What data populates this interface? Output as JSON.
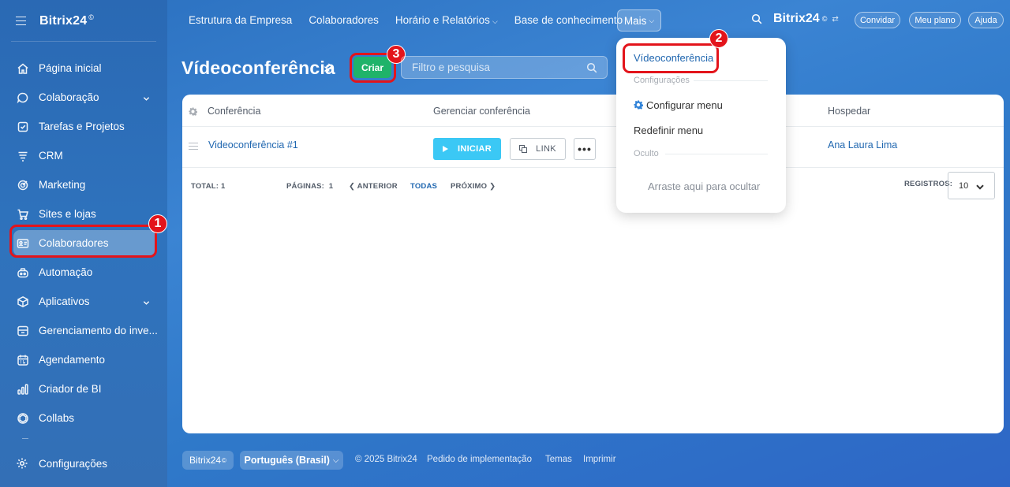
{
  "sidebar": {
    "brand": "Bitrix24",
    "brand_mark": "©",
    "items": [
      {
        "label": "Página inicial",
        "icon": "home-icon"
      },
      {
        "label": "Colaboração",
        "icon": "chat-icon",
        "expandable": true
      },
      {
        "label": "Tarefas e Projetos",
        "icon": "task-icon"
      },
      {
        "label": "CRM",
        "icon": "crm-icon"
      },
      {
        "label": "Marketing",
        "icon": "marketing-icon"
      },
      {
        "label": "Sites e lojas",
        "icon": "cart-icon"
      },
      {
        "label": "Colaboradores",
        "icon": "id-card-icon",
        "active": true
      },
      {
        "label": "Automação",
        "icon": "robot-icon"
      },
      {
        "label": "Aplicativos",
        "icon": "cube-icon",
        "expandable": true
      },
      {
        "label": "Gerenciamento do inve...",
        "icon": "inventory-icon"
      },
      {
        "label": "Agendamento",
        "icon": "calendar-icon"
      },
      {
        "label": "Criador de BI",
        "icon": "bar-chart-icon"
      },
      {
        "label": "Collabs",
        "icon": "collabs-icon"
      }
    ],
    "settings_label": "Configurações"
  },
  "topbar": {
    "nav": [
      {
        "label": "Estrutura da Empresa",
        "caret": false
      },
      {
        "label": "Colaboradores",
        "caret": false
      },
      {
        "label": "Horário e Relatórios",
        "caret": true
      },
      {
        "label": "Base de conhecimento",
        "caret": false
      }
    ],
    "more_label": "Mais",
    "brand": "Bitrix24",
    "brand_mark": "©",
    "invite_label": "Convidar",
    "plan_label": "Meu plano",
    "help_label": "Ajuda"
  },
  "page": {
    "title": "Vídeoconferência",
    "create_label": "Criar",
    "filter_placeholder": "Filtro e pesquisa"
  },
  "table": {
    "columns": {
      "conference": "Conferência",
      "manage": "Gerenciar conferência",
      "host": "Hospedar"
    },
    "rows": [
      {
        "conference": "Videoconferência #1",
        "start_label": "INICIAR",
        "link_label": "LINK",
        "more_label": "•••",
        "host": "Ana Laura Lima"
      }
    ],
    "pager": {
      "total_label": "TOTAL:",
      "total_value": "1",
      "pages_label": "PÁGINAS:",
      "pages_value": "1",
      "prev_label": "ANTERIOR",
      "all_label": "TODAS",
      "next_label": "PRÓXIMO",
      "records_label": "REGISTROS:",
      "records_value": "10"
    }
  },
  "dropdown": {
    "item_video": "Vídeoconferência",
    "settings_caption": "Configurações",
    "configure_menu": "Configurar menu",
    "reset_menu": "Redefinir menu",
    "hidden_caption": "Oculto",
    "drag_hint": "Arraste aqui para ocultar"
  },
  "footer": {
    "brand": "Bitrix24",
    "brand_mark": "©",
    "language": "Português (Brasil)",
    "copyright": "© 2025 Bitrix24",
    "implementation": "Pedido de implementação",
    "themes": "Temas",
    "print": "Imprimir"
  },
  "annotations": {
    "badge_1": "1",
    "badge_2": "2",
    "badge_3": "3",
    "highlight_color": "#e3141b"
  },
  "colors": {
    "accent_green": "#1fb36a",
    "start_blue": "#3bc8f5",
    "link_blue": "#2067b0"
  }
}
